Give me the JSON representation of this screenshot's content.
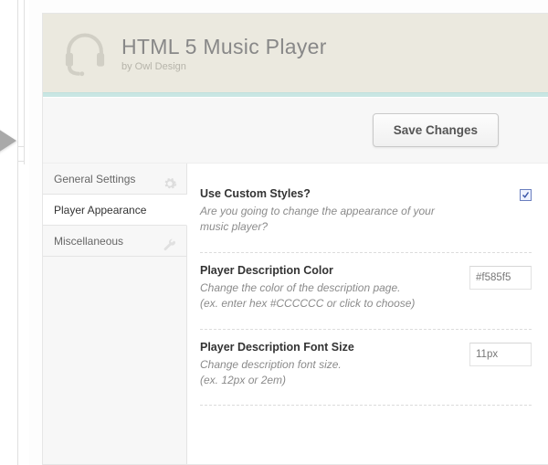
{
  "header": {
    "title": "HTML 5 Music Player",
    "byline": "by Owl Design"
  },
  "toolbar": {
    "save_label": "Save Changes"
  },
  "sidebar": {
    "items": [
      {
        "label": "General Settings"
      },
      {
        "label": "Player Appearance"
      },
      {
        "label": "Miscellaneous"
      }
    ],
    "active_index": 1
  },
  "settings": [
    {
      "label": "Use Custom Styles?",
      "desc": "Are you going to change the appearance of your music player?",
      "type": "checkbox",
      "checked": true
    },
    {
      "label": "Player Description Color",
      "desc": "Change the color of the description page.",
      "hint": "(ex. enter hex #CCCCCC or click to choose)",
      "type": "text",
      "value": "#f585f5"
    },
    {
      "label": "Player Description Font Size",
      "desc": "Change description font size.",
      "hint": "(ex. 12px or 2em)",
      "type": "text",
      "value": "11px"
    }
  ]
}
